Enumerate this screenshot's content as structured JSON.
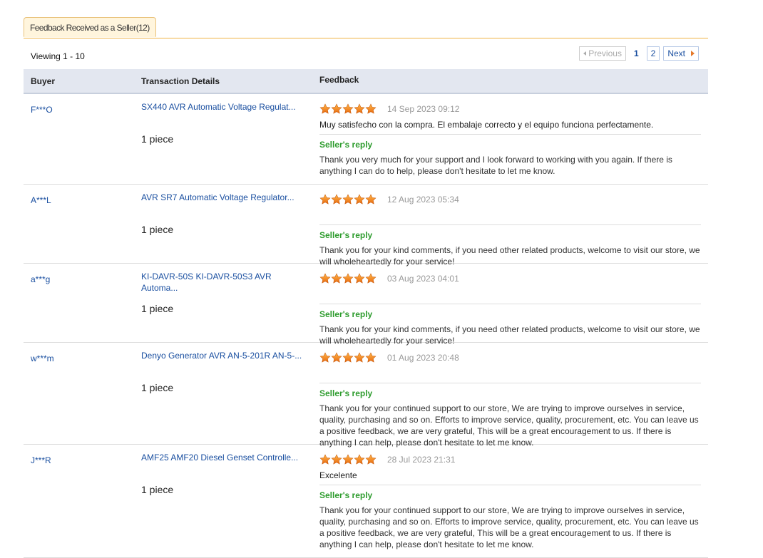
{
  "tab": {
    "label": "Feedback Received as a Seller(12)"
  },
  "viewing": "Viewing 1 - 10",
  "pager": {
    "previous": "Previous",
    "current": "1",
    "page2": "2",
    "next": "Next"
  },
  "columns": {
    "buyer": "Buyer",
    "transaction": "Transaction Details",
    "feedback": "Feedback"
  },
  "seller_reply_label": "Seller's reply",
  "rating_max": 5,
  "colors": {
    "link": "#1a4fa0",
    "reply_label": "#2e9c2e",
    "tab_border": "#f0b445",
    "header_bg": "#e3e7f0"
  },
  "rows": [
    {
      "buyer": "F***O",
      "product": "SX440 AVR Automatic Voltage Regulat...",
      "quantity": "1 piece",
      "rating": 5,
      "date": "14 Sep 2023 09:12",
      "comment": "Muy satisfecho con la compra. El embalaje correcto y el equipo funciona perfectamente.",
      "reply": "Thank you very much for your support and I look forward to working with you again. If there is anything I can do to help, please don't hesitate to let me know."
    },
    {
      "buyer": "A***L",
      "product": "AVR SR7 Automatic Voltage Regulator...",
      "quantity": "1 piece",
      "rating": 5,
      "date": "12 Aug 2023 05:34",
      "comment": "",
      "reply": "Thank you for your kind comments, if you need other related products, welcome to visit our store, we will wholeheartedly for your service!"
    },
    {
      "buyer": "a***g",
      "product": "KI-DAVR-50S KI-DAVR-50S3 AVR Automa...",
      "quantity": "1 piece",
      "rating": 5,
      "date": "03 Aug 2023 04:01",
      "comment": "",
      "reply": "Thank you for your kind comments, if you need other related products, welcome to visit our store, we will wholeheartedly for your service!"
    },
    {
      "buyer": "w***m",
      "product": "Denyo Generator AVR AN-5-201R AN-5-...",
      "quantity": "1 piece",
      "rating": 5,
      "date": "01 Aug 2023 20:48",
      "comment": "",
      "reply": "Thank you for your continued support to our store, We are trying to improve ourselves in service, quality, purchasing and so on. Efforts to improve service, quality, procurement, etc. You can leave us a positive feedback, we are very grateful, This will be a great encouragement to us. If there is anything I can help, please don't hesitate to let me know."
    },
    {
      "buyer": "J***R",
      "product": "AMF25 AMF20 Diesel Genset Controlle...",
      "quantity": "1 piece",
      "rating": 5,
      "date": "28 Jul 2023 21:31",
      "comment": "Excelente",
      "reply": "Thank you for your continued support to our store, We are trying to improve ourselves in service, quality, purchasing and so on. Efforts to improve service, quality, procurement, etc. You can leave us a positive feedback, we are very grateful, This will be a great encouragement to us. If there is anything I can help, please don't hesitate to let me know."
    }
  ]
}
